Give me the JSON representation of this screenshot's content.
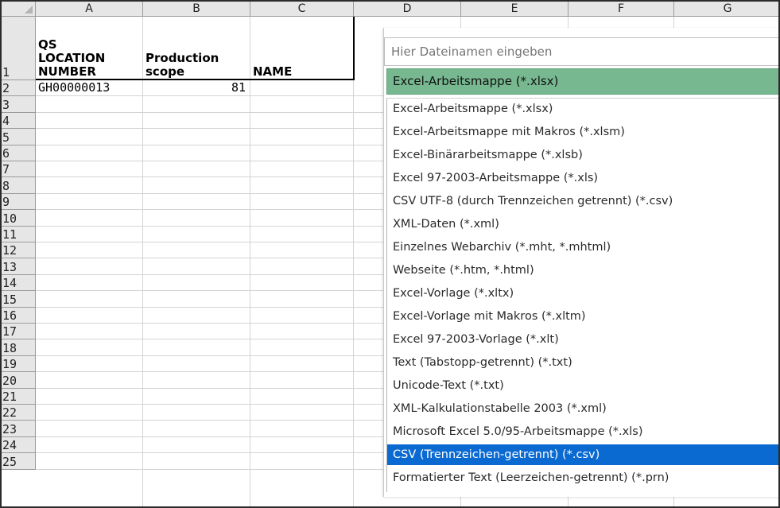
{
  "columns": [
    "A",
    "B",
    "C",
    "D",
    "E",
    "F",
    "G"
  ],
  "rows": [
    "1",
    "2",
    "3",
    "4",
    "5",
    "6",
    "7",
    "8",
    "9",
    "10",
    "11",
    "12",
    "13",
    "14",
    "15",
    "16",
    "17",
    "18",
    "19",
    "20",
    "21",
    "22",
    "23",
    "24",
    "25"
  ],
  "header": {
    "a": [
      "QS",
      "LOCATION",
      "NUMBER"
    ],
    "b": [
      "Production",
      "scope"
    ],
    "c": "NAME"
  },
  "row2": {
    "a": "GH00000013",
    "b": "81"
  },
  "dialog": {
    "filename_placeholder": "Hier Dateinamen eingeben",
    "selected_type": "Excel-Arbeitsmappe (*.xlsx)",
    "file_types": [
      "Excel-Arbeitsmappe (*.xlsx)",
      "Excel-Arbeitsmappe mit Makros (*.xlsm)",
      "Excel-Binärarbeitsmappe (*.xlsb)",
      "Excel 97-2003-Arbeitsmappe (*.xls)",
      "CSV UTF-8 (durch Trennzeichen getrennt) (*.csv)",
      "XML-Daten (*.xml)",
      "Einzelnes Webarchiv (*.mht, *.mhtml)",
      "Webseite (*.htm, *.html)",
      "Excel-Vorlage (*.xltx)",
      "Excel-Vorlage mit Makros (*.xltm)",
      "Excel 97-2003-Vorlage (*.xlt)",
      "Text (Tabstopp-getrennt) (*.txt)",
      "Unicode-Text (*.txt)",
      "XML-Kalkulationstabelle 2003 (*.xml)",
      "Microsoft Excel 5.0/95-Arbeitsmappe (*.xls)",
      "CSV (Trennzeichen-getrennt) (*.csv)",
      "Formatierter Text (Leerzeichen-getrennt) (*.prn)"
    ],
    "highlighted_type": "CSV (Trennzeichen-getrennt) (*.csv)",
    "colors": {
      "selected_bg": "#77b890",
      "highlight_bg": "#0a6ad2"
    }
  }
}
